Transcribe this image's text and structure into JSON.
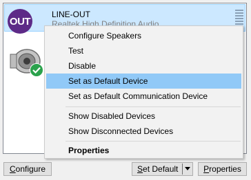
{
  "device": {
    "icon_text": "OUT",
    "name": "LINE-OUT",
    "driver": "Realtek High Definition Audio"
  },
  "context_menu": {
    "items": [
      {
        "label": "Configure Speakers"
      },
      {
        "label": "Test"
      },
      {
        "label": "Disable"
      },
      {
        "label": "Set as Default Device",
        "highlighted": true
      },
      {
        "label": "Set as Default Communication Device"
      },
      {
        "label": "Show Disabled Devices"
      },
      {
        "label": "Show Disconnected Devices"
      },
      {
        "label": "Properties",
        "bold": true
      }
    ]
  },
  "buttons": {
    "configure": {
      "mnemonic": "C",
      "rest": "onfigure"
    },
    "set_default": {
      "mnemonic": "S",
      "rest": "et Default"
    },
    "properties": {
      "mnemonic": "P",
      "rest": "roperties"
    }
  },
  "colors": {
    "selection": "#cce8ff",
    "menu_highlight": "#91c9f7",
    "out_icon": "#5d2a87",
    "check_badge": "#2ba24c"
  }
}
